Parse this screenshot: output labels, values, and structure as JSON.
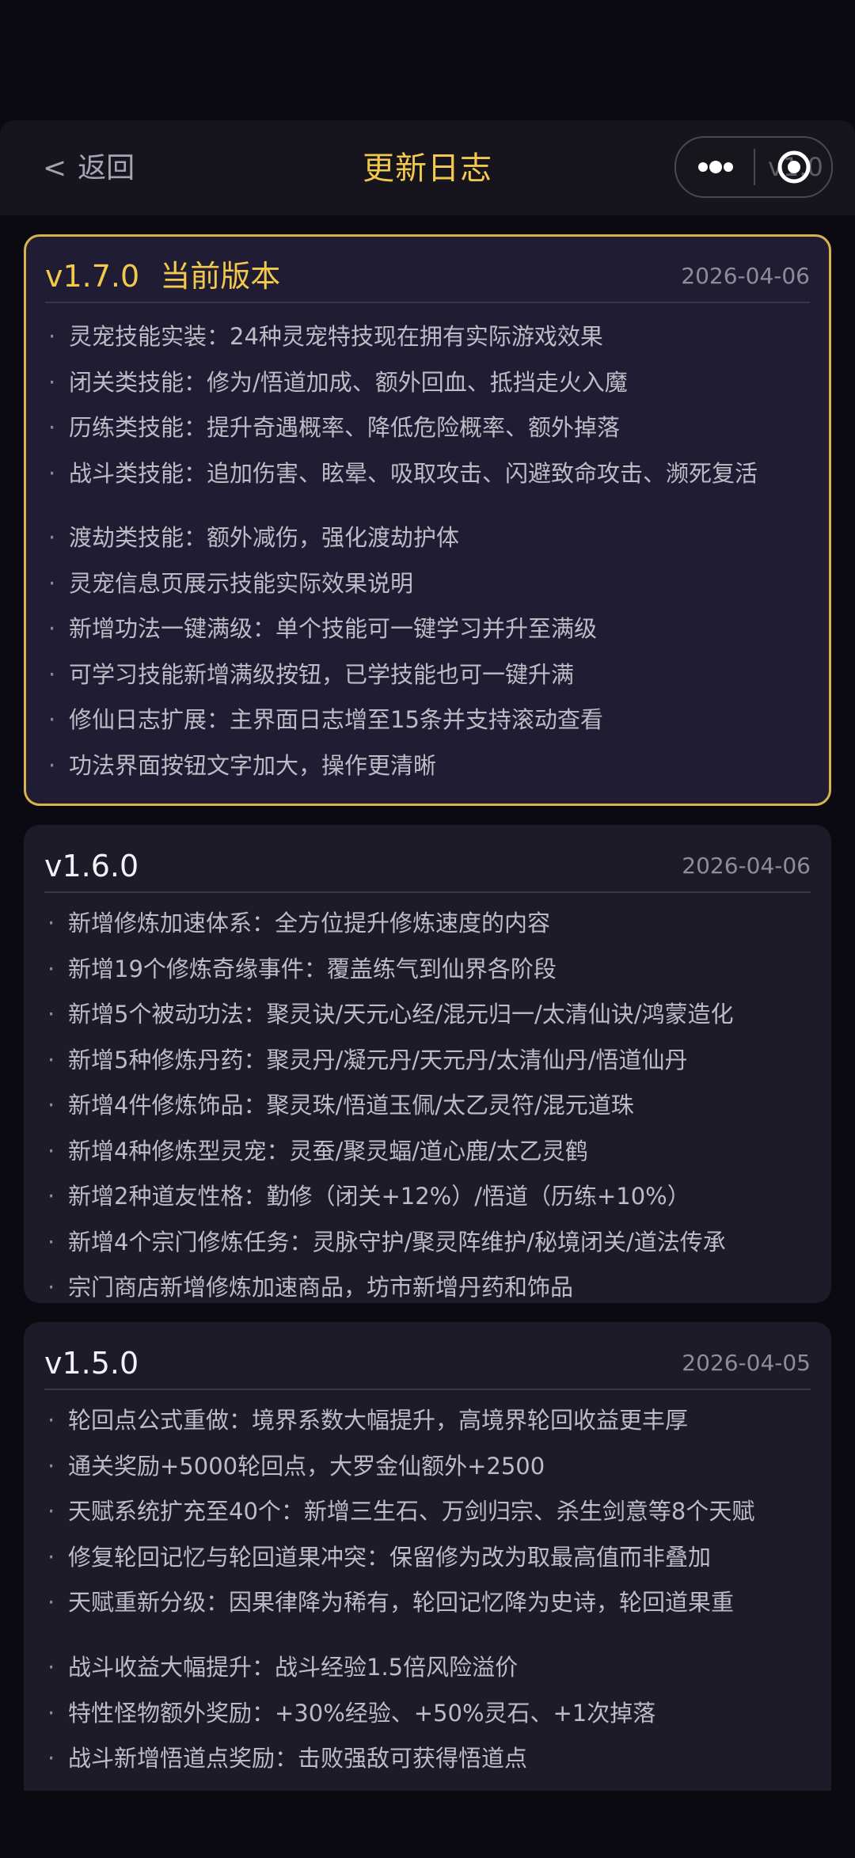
{
  "nav": {
    "back_label": "返回",
    "back_icon": "<",
    "title": "更新日志",
    "capsule_version": "v1.0"
  },
  "changelog": [
    {
      "version": "v1.7.0",
      "tag": "当前版本",
      "date": "2026-04-06",
      "items": [
        "灵宠技能实装：24种灵宠特技现在拥有实际游戏效果",
        "闭关类技能：修为/悟道加成、额外回血、抵挡走火入魔",
        "历练类技能：提升奇遇概率、降低危险概率、额外掉落",
        "战斗类技能：追加伤害、眩晕、吸取攻击、闪避致命攻击、濒死复活",
        "渡劫类技能：额外减伤，强化渡劫护体",
        "灵宠信息页展示技能实际效果说明",
        "新增功法一键满级：单个技能可一键学习并升至满级",
        "可学习技能新增满级按钮，已学技能也可一键升满",
        "修仙日志扩展：主界面日志增至15条并支持滚动查看",
        "功法界面按钮文字加大，操作更清晰"
      ]
    },
    {
      "version": "v1.6.0",
      "tag": "",
      "date": "2026-04-06",
      "items": [
        "新增修炼加速体系：全方位提升修炼速度的内容",
        "新增19个修炼奇缘事件：覆盖练气到仙界各阶段",
        "新增5个被动功法：聚灵诀/天元心经/混元归一/太清仙诀/鸿蒙造化",
        "新增5种修炼丹药：聚灵丹/凝元丹/天元丹/太清仙丹/悟道仙丹",
        "新增4件修炼饰品：聚灵珠/悟道玉佩/太乙灵符/混元道珠",
        "新增4种修炼型灵宠：灵蚕/聚灵蝠/道心鹿/太乙灵鹤",
        "新增2种道友性格：勤修（闭关+12%）/悟道（历练+10%）",
        "新增4个宗门修炼任务：灵脉守护/聚灵阵维护/秘境闭关/道法传承",
        "宗门商店新增修炼加速商品，坊市新增丹药和饰品"
      ]
    },
    {
      "version": "v1.5.0",
      "tag": "",
      "date": "2026-04-05",
      "items": [
        "轮回点公式重做：境界系数大幅提升，高境界轮回收益更丰厚",
        "通关奖励+5000轮回点，大罗金仙额外+2500",
        "天赋系统扩充至40个：新增三生石、万剑归宗、杀生剑意等8个天赋",
        "修复轮回记忆与轮回道果冲突：保留修为改为取最高值而非叠加",
        "天赋重新分级：因果律降为稀有，轮回记忆降为史诗，轮回道果重",
        "战斗收益大幅提升：战斗经验1.5倍风险溢价",
        "特性怪物额外奖励：+30%经验、+50%灵石、+1次掉落",
        "战斗新增悟道点奖励：击败强敌可获得悟道点"
      ]
    }
  ]
}
